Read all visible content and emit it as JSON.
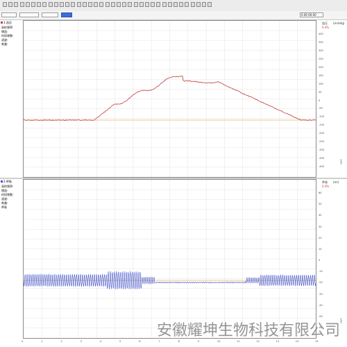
{
  "toolbar": {
    "buttons": [
      "tb-1",
      "tb-2",
      "tb-3",
      "tb-4",
      "tb-5",
      "tb-6",
      "tb-7",
      "tb-8",
      "tb-9",
      "tb-10",
      "tb-11",
      "tb-12",
      "tb-13",
      "tb-14",
      "tb-15",
      "tb-16",
      "tb-17",
      "tb-18",
      "tb-19",
      "tb-20",
      "tb-21",
      "tb-22",
      "tb-23",
      "tb-24",
      "tb-25",
      "tb-26",
      "tb-27",
      "tb-28",
      "tb-29",
      "tb-30",
      "tb-31",
      "tb-32",
      "tb-33",
      "tb-34",
      "tb-35",
      "tb-36",
      "tb-37"
    ]
  },
  "selectbar": {
    "s1": "",
    "s2": "",
    "s3": "",
    "s4": "",
    "right_text": "0.00  00.00"
  },
  "channel1": {
    "color": "#c83c3c",
    "header": "1.血压",
    "info": [
      "采样频率:",
      "增益:",
      "时间常数:",
      "滤波:",
      "刺激:"
    ],
    "right_title": "血压",
    "right_value": "0.4%",
    "unit": "(mmHg)",
    "side_tag": "DIFF",
    "yticks": [
      "400",
      "350",
      "300",
      "250",
      "200",
      "150",
      "100",
      "50",
      "0",
      "-50",
      "-100",
      "-150",
      "-200",
      "-250",
      "-300",
      "-350",
      "-400"
    ]
  },
  "channel2": {
    "color": "#4455cc",
    "header": "2.呼吸",
    "info": [
      "采样频率:",
      "增益:",
      "时间常数:",
      "滤波:",
      "刺激:",
      "呼吸"
    ],
    "right_title": "呼吸",
    "right_value": "0.4%",
    "unit": "(ml)",
    "side_tag": "DIFF",
    "yticks": [
      "60",
      "50",
      "40",
      "30",
      "20",
      "10",
      "0",
      "-10",
      "-20",
      "-30",
      "-40",
      "-50",
      "-60"
    ]
  },
  "xaxis": {
    "ticks": [
      "0",
      "1",
      "2",
      "3",
      "4",
      "5",
      "6",
      "7",
      "8",
      "9",
      "10",
      "11",
      "12",
      "13",
      "14",
      "15"
    ]
  },
  "watermark": "安徽耀坤生物科技有限公司"
}
